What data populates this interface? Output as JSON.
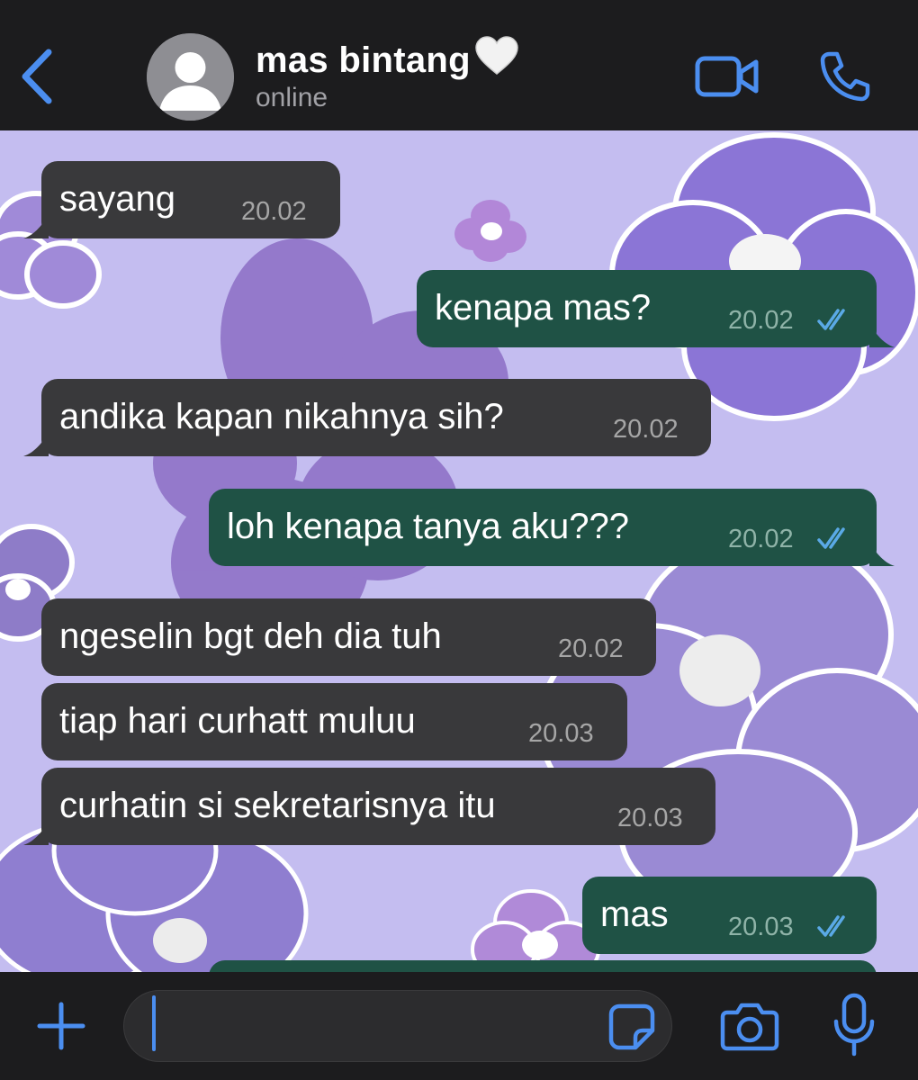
{
  "header": {
    "contact_name": "mas bintang",
    "status": "online",
    "accent_color": "#4b8ef0"
  },
  "messages": [
    {
      "direction": "incoming",
      "text": "sayang",
      "time": "20.02"
    },
    {
      "direction": "outgoing",
      "text": "kenapa mas?",
      "time": "20.02",
      "read": true
    },
    {
      "direction": "incoming",
      "text": "andika kapan nikahnya sih?",
      "time": "20.02"
    },
    {
      "direction": "outgoing",
      "text": "loh kenapa tanya aku???",
      "time": "20.02",
      "read": true
    },
    {
      "direction": "incoming",
      "text": "ngeselin bgt deh dia tuh",
      "time": "20.02"
    },
    {
      "direction": "incoming",
      "text": "tiap hari curhatt muluu",
      "time": "20.03"
    },
    {
      "direction": "incoming",
      "text": "curhatin si sekretarisnya itu",
      "time": "20.03"
    },
    {
      "direction": "outgoing",
      "text": "mas",
      "time": "20.03",
      "read": true
    }
  ],
  "composer": {
    "value": "",
    "placeholder": ""
  },
  "icons": {
    "back": "chevron-left-icon",
    "video": "video-camera-icon",
    "call": "phone-icon",
    "plus": "plus-icon",
    "sticker": "sticker-icon",
    "camera": "camera-icon",
    "mic": "microphone-icon"
  },
  "colors": {
    "incoming_bubble": "#39393b",
    "outgoing_bubble": "#1f5245",
    "wallpaper": "#c4bdf0",
    "read_ticks": "#5aa9e6"
  }
}
